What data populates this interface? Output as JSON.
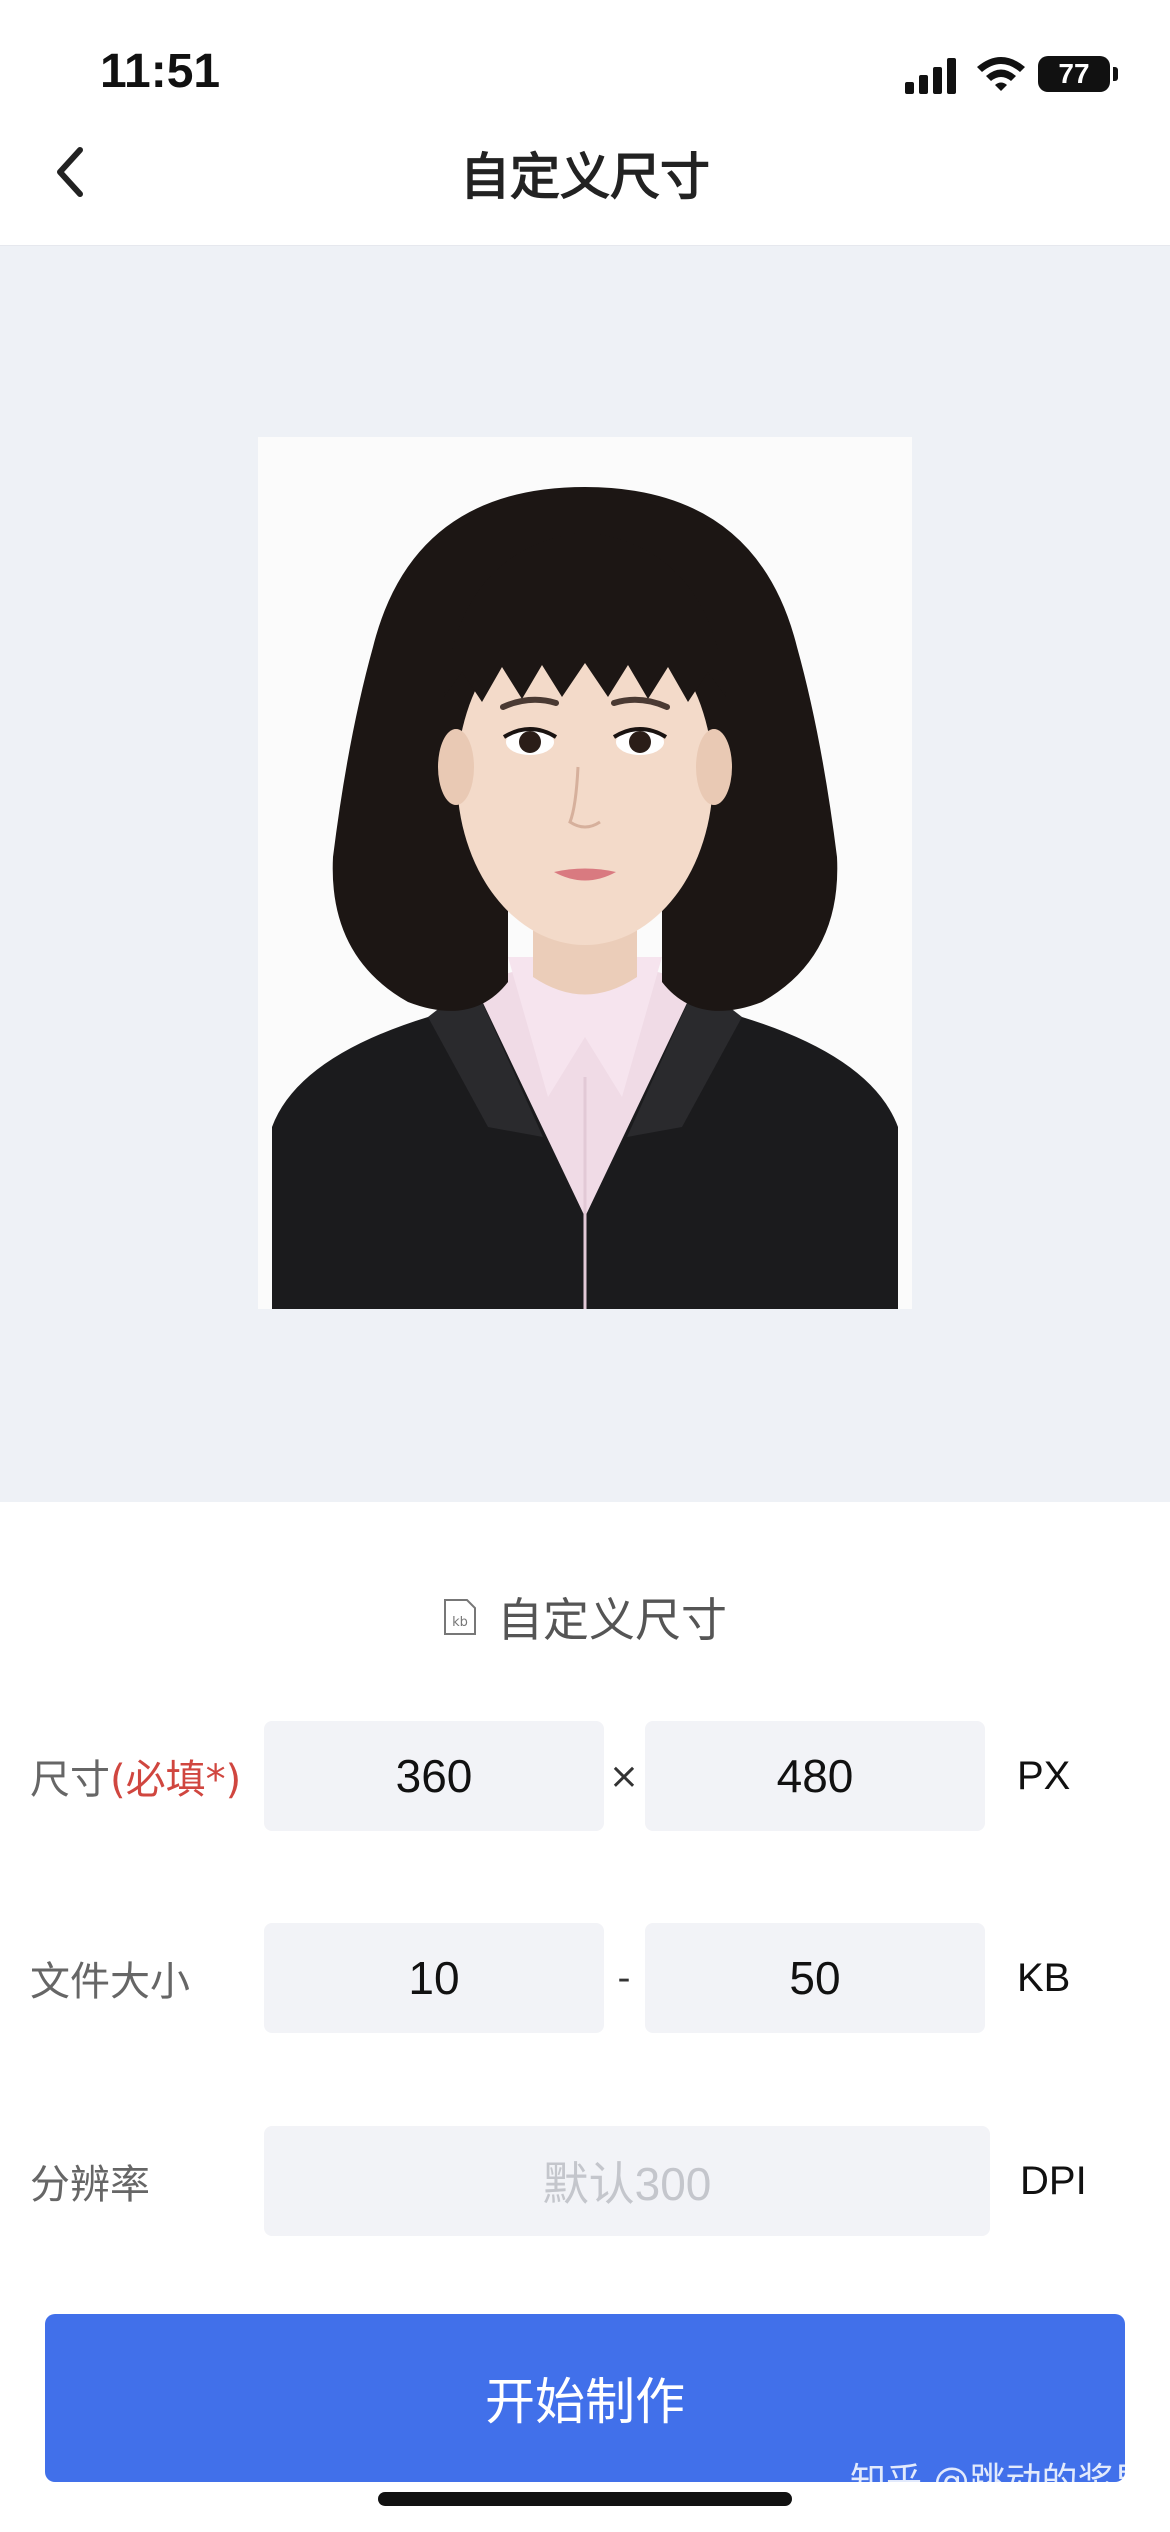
{
  "status_bar": {
    "time": "11:51",
    "battery": "77",
    "icons": [
      "signal-icon",
      "wifi-icon",
      "battery-icon"
    ]
  },
  "nav": {
    "title": "自定义尺寸",
    "back_icon": "chevron-left-icon"
  },
  "form": {
    "section_title": "自定义尺寸",
    "section_icon": "kb-file-icon",
    "size": {
      "label": "尺寸",
      "required": "(必填*)",
      "width": "360",
      "separator": "×",
      "height": "480",
      "unit": "PX"
    },
    "file_size": {
      "label": "文件大小",
      "min": "10",
      "separator": "-",
      "max": "50",
      "unit": "KB"
    },
    "resolution": {
      "label": "分辨率",
      "placeholder": "默认300",
      "unit": "DPI"
    },
    "submit_label": "开始制作"
  },
  "watermark": "知乎 @跳动的浆果",
  "colors": {
    "accent": "#4170ea",
    "required": "#d0463f",
    "preview_bg": "#eef1f6",
    "field_bg": "#f2f3f7"
  }
}
